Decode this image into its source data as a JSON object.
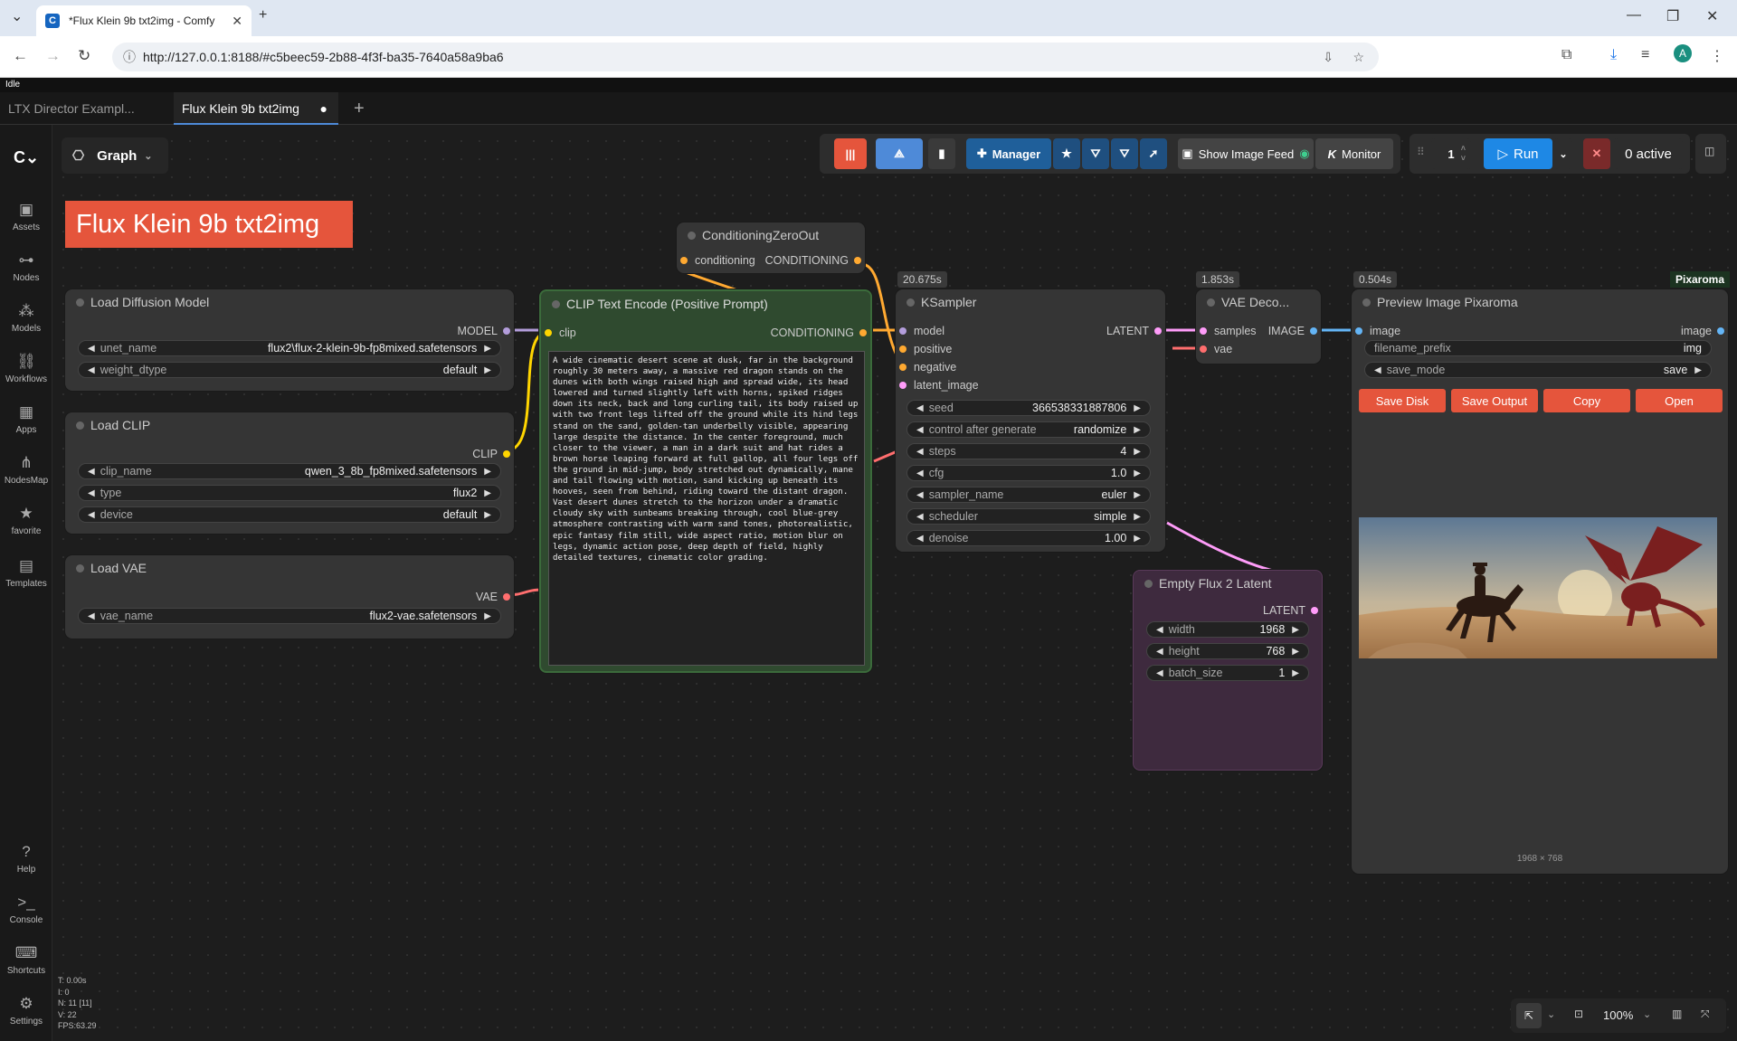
{
  "browser": {
    "tab_title": "*Flux Klein 9b txt2img - Comfy",
    "url": "http://127.0.0.1:8188/#c5beec59-2b88-4f3f-ba35-7640a58a9ba6",
    "profile_initial": "A"
  },
  "status": "Idle",
  "workflow_tabs": [
    {
      "label": "LTX Director Exampl..."
    },
    {
      "label": "Flux Klein 9b txt2img"
    }
  ],
  "sidebar": [
    {
      "label": "Assets",
      "icon": "image-icon"
    },
    {
      "label": "Nodes",
      "icon": "nodes-icon"
    },
    {
      "label": "Models",
      "icon": "models-icon"
    },
    {
      "label": "Workflows",
      "icon": "workflow-icon"
    },
    {
      "label": "Apps",
      "icon": "apps-icon"
    },
    {
      "label": "NodesMap",
      "icon": "map-icon"
    },
    {
      "label": "favorite",
      "icon": "star-icon"
    },
    {
      "label": "Templates",
      "icon": "templates-icon"
    },
    {
      "label": "Help",
      "icon": "help-icon"
    },
    {
      "label": "Console",
      "icon": "console-icon"
    },
    {
      "label": "Shortcuts",
      "icon": "keyboard-icon"
    },
    {
      "label": "Settings",
      "icon": "gear-icon"
    }
  ],
  "graph_menu": "Graph",
  "toolbar": {
    "manager": "Manager",
    "show_feed": "Show Image Feed",
    "monitor": "Monitor",
    "monitor_prefix": "K",
    "queue_count": "1",
    "run": "Run",
    "active": "0 active"
  },
  "canvas_title": "Flux Klein 9b txt2img",
  "nodes": {
    "load_model": {
      "title": "Load Diffusion Model",
      "out": "MODEL",
      "unet_label": "unet_name",
      "unet_value": "flux2\\flux-2-klein-9b-fp8mixed.safetensors",
      "dtype_label": "weight_dtype",
      "dtype_value": "default"
    },
    "load_clip": {
      "title": "Load CLIP",
      "out": "CLIP",
      "name_label": "clip_name",
      "name_value": "qwen_3_8b_fp8mixed.safetensors",
      "type_label": "type",
      "type_value": "flux2",
      "device_label": "device",
      "device_value": "default"
    },
    "load_vae": {
      "title": "Load VAE",
      "out": "VAE",
      "name_label": "vae_name",
      "name_value": "flux2-vae.safetensors"
    },
    "zero_out": {
      "title": "ConditioningZeroOut",
      "in": "conditioning",
      "out": "CONDITIONING"
    },
    "clip_text": {
      "title": "CLIP Text Encode (Positive Prompt)",
      "in": "clip",
      "out": "CONDITIONING",
      "prompt": "A wide cinematic desert scene at dusk, far in the background roughly 30 meters away, a massive red dragon stands on the dunes with both wings raised high and spread wide, its head lowered and turned slightly left with horns, spiked ridges down its neck, back and long curling tail, its body raised up with two front legs lifted off the ground while its hind legs stand on the sand, golden-tan underbelly visible, appearing large despite the distance. In the center foreground, much closer to the viewer, a man in a dark suit and hat rides a brown horse leaping forward at full gallop, all four legs off the ground in mid-jump, body stretched out dynamically, mane and tail flowing with motion, sand kicking up beneath its hooves, seen from behind, riding toward the distant dragon. Vast desert dunes stretch to the horizon under a dramatic cloudy sky with sunbeams breaking through, cool blue-grey atmosphere contrasting with warm sand tones, photorealistic, epic fantasy film still, wide aspect ratio, motion blur on legs, dynamic action pose, deep depth of field, highly detailed textures, cinematic color grading."
    },
    "ksampler": {
      "title": "KSampler",
      "timer": "20.675s",
      "in_model": "model",
      "in_pos": "positive",
      "in_neg": "negative",
      "in_latent": "latent_image",
      "out": "LATENT",
      "widgets": [
        {
          "label": "seed",
          "value": "366538331887806"
        },
        {
          "label": "control after generate",
          "value": "randomize"
        },
        {
          "label": "steps",
          "value": "4"
        },
        {
          "label": "cfg",
          "value": "1.0"
        },
        {
          "label": "sampler_name",
          "value": "euler"
        },
        {
          "label": "scheduler",
          "value": "simple"
        },
        {
          "label": "denoise",
          "value": "1.00"
        }
      ]
    },
    "vae_decode": {
      "title": "VAE Deco...",
      "timer": "1.853s",
      "in_samples": "samples",
      "in_vae": "vae",
      "out": "IMAGE"
    },
    "preview": {
      "title": "Preview Image Pixaroma",
      "timer": "0.504s",
      "badge": "Pixaroma",
      "in": "image",
      "out": "image",
      "prefix_label": "filename_prefix",
      "prefix_value": "img",
      "mode_label": "save_mode",
      "mode_value": "save",
      "buttons": [
        "Save Disk",
        "Save Output",
        "Copy",
        "Open"
      ],
      "dims": "1968 × 768"
    },
    "empty_latent": {
      "title": "Empty Flux 2 Latent",
      "out": "LATENT",
      "widgets": [
        {
          "label": "width",
          "value": "1968"
        },
        {
          "label": "height",
          "value": "768"
        },
        {
          "label": "batch_size",
          "value": "1"
        }
      ]
    }
  },
  "stats": [
    "T: 0.00s",
    "I: 0",
    "N: 11 [11]",
    "V: 22",
    "FPS:63.29"
  ],
  "zoom": "100%",
  "colors": {
    "accent": "#e5553c",
    "run": "#1e88e5",
    "link_model": "#b39ddb",
    "link_clip": "#ffd500",
    "link_cond": "#ffa931",
    "link_latent": "#ff9cf9",
    "link_vae": "#ff6e6e",
    "link_image": "#64b5f6"
  }
}
